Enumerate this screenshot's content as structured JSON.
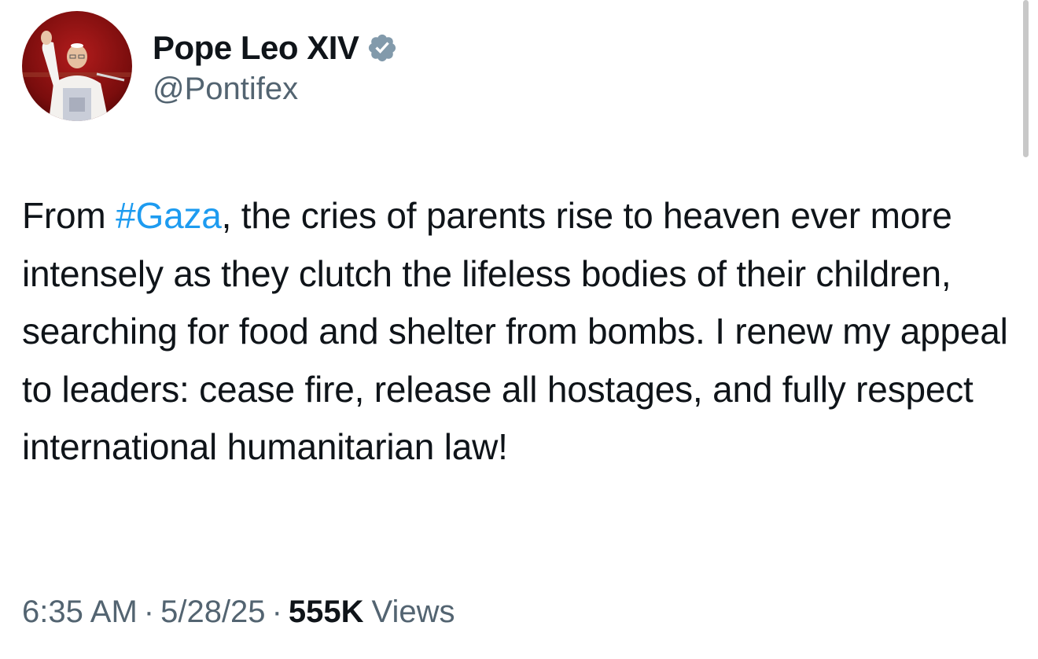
{
  "tweet": {
    "author": {
      "display_name": "Pope Leo XIV",
      "handle": "@Pontifex",
      "verified": true,
      "verified_icon": "verified-badge-icon",
      "verified_color": "#829aab"
    },
    "text": {
      "prefix": "From ",
      "hashtag": "#Gaza",
      "rest": ", the cries of parents rise to heaven ever more intensely as they clutch the lifeless bodies of their children, searching for food and shelter from bombs. I renew my appeal to leaders: cease fire, release all hostages, and fully respect international humanitarian law!"
    },
    "meta": {
      "time": "6:35 AM",
      "separator": "·",
      "date": "5/28/25",
      "views_count": "555K",
      "views_label": "Views"
    }
  },
  "colors": {
    "text_primary": "#0f1419",
    "text_secondary": "#536471",
    "hashtag": "#1d9bf0"
  }
}
